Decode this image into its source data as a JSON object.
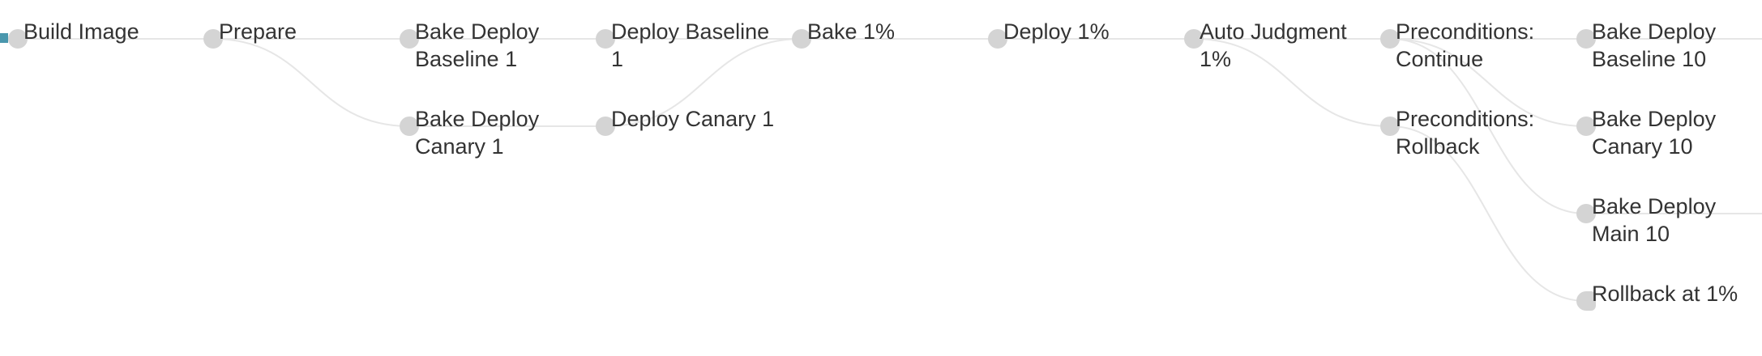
{
  "colors": {
    "node": "#d4d4d4",
    "edge": "#e6e6e6",
    "text": "#333333",
    "active_marker": "#4a97ad"
  },
  "nodes": [
    {
      "id": "build-image",
      "label": "Build Image"
    },
    {
      "id": "prepare",
      "label": "Prepare"
    },
    {
      "id": "bake-deploy-baseline-1",
      "label": "Bake Deploy\nBaseline 1"
    },
    {
      "id": "bake-deploy-canary-1",
      "label": "Bake Deploy\nCanary 1"
    },
    {
      "id": "deploy-baseline-1",
      "label": "Deploy Baseline\n1"
    },
    {
      "id": "deploy-canary-1",
      "label": "Deploy Canary 1"
    },
    {
      "id": "bake-1pct",
      "label": "Bake 1%"
    },
    {
      "id": "deploy-1pct",
      "label": "Deploy 1%"
    },
    {
      "id": "auto-judgment-1pct",
      "label": "Auto Judgment\n1%"
    },
    {
      "id": "preconditions-continue",
      "label": "Preconditions:\nContinue"
    },
    {
      "id": "preconditions-rollback",
      "label": "Preconditions:\nRollback"
    },
    {
      "id": "bake-deploy-baseline-10",
      "label": "Bake Deploy\nBaseline 10"
    },
    {
      "id": "bake-deploy-canary-10",
      "label": "Bake Deploy\nCanary 10"
    },
    {
      "id": "bake-deploy-main-10",
      "label": "Bake Deploy\nMain 10"
    },
    {
      "id": "rollback-at-1pct",
      "label": "Rollback at 1%"
    }
  ],
  "edges": [
    [
      "build-image",
      "prepare"
    ],
    [
      "prepare",
      "bake-deploy-baseline-1"
    ],
    [
      "prepare",
      "bake-deploy-canary-1"
    ],
    [
      "bake-deploy-baseline-1",
      "deploy-baseline-1"
    ],
    [
      "bake-deploy-canary-1",
      "deploy-canary-1"
    ],
    [
      "deploy-baseline-1",
      "bake-1pct"
    ],
    [
      "deploy-canary-1",
      "bake-1pct"
    ],
    [
      "bake-1pct",
      "deploy-1pct"
    ],
    [
      "deploy-1pct",
      "auto-judgment-1pct"
    ],
    [
      "auto-judgment-1pct",
      "preconditions-continue"
    ],
    [
      "auto-judgment-1pct",
      "preconditions-rollback"
    ],
    [
      "preconditions-continue",
      "bake-deploy-baseline-10"
    ],
    [
      "preconditions-continue",
      "bake-deploy-canary-10"
    ],
    [
      "preconditions-continue",
      "bake-deploy-main-10"
    ],
    [
      "preconditions-rollback",
      "rollback-at-1pct"
    ],
    [
      "bake-deploy-baseline-10",
      "offscreen"
    ],
    [
      "bake-deploy-main-10",
      "offscreen"
    ]
  ]
}
